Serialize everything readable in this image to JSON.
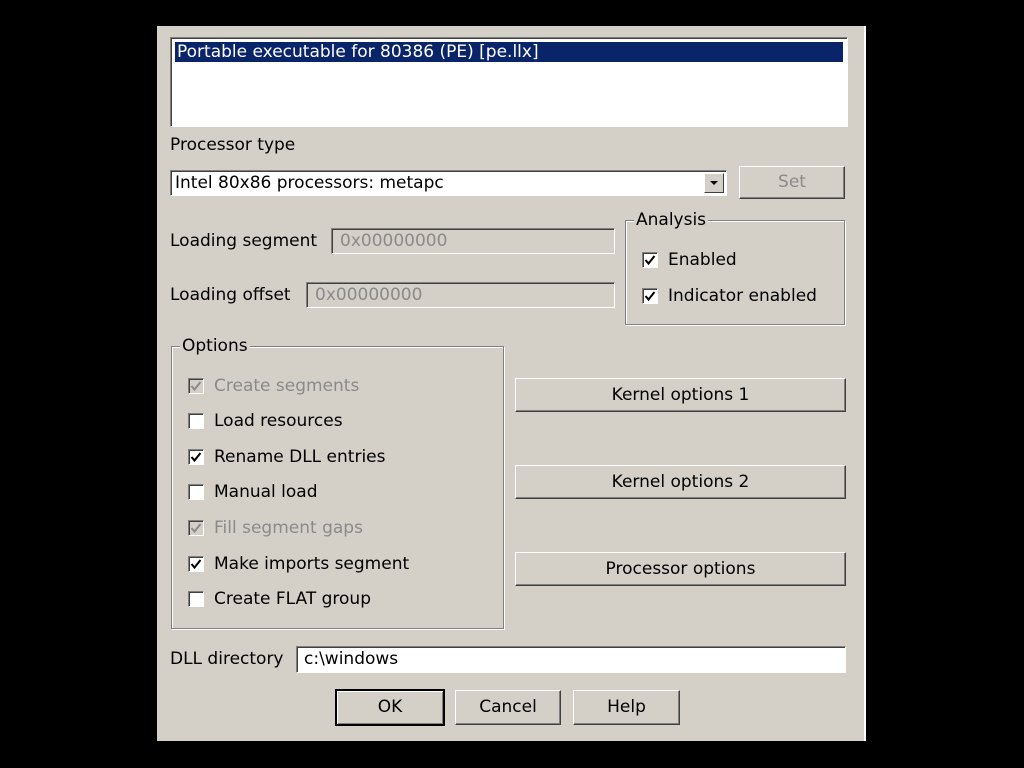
{
  "loader_list": {
    "selected": "Portable executable for 80386 (PE) [pe.llx]"
  },
  "processor": {
    "label": "Processor type",
    "value": "Intel 80x86 processors: metapc",
    "set_button": "Set"
  },
  "loading": {
    "segment_label": "Loading segment",
    "segment_value": "0x00000000",
    "offset_label": "Loading offset",
    "offset_value": "0x00000000"
  },
  "analysis": {
    "title": "Analysis",
    "items": [
      {
        "label": "Enabled",
        "checked": true,
        "disabled": false
      },
      {
        "label": "Indicator enabled",
        "checked": true,
        "disabled": false
      }
    ]
  },
  "options": {
    "title": "Options",
    "items": [
      {
        "label": "Create segments",
        "checked": true,
        "disabled": true
      },
      {
        "label": "Load resources",
        "checked": false,
        "disabled": false
      },
      {
        "label": "Rename DLL entries",
        "checked": true,
        "disabled": false
      },
      {
        "label": "Manual load",
        "checked": false,
        "disabled": false
      },
      {
        "label": "Fill segment gaps",
        "checked": true,
        "disabled": true
      },
      {
        "label": "Make imports segment",
        "checked": true,
        "disabled": false
      },
      {
        "label": "Create FLAT group",
        "checked": false,
        "disabled": false
      }
    ]
  },
  "kernel": {
    "options1": "Kernel options 1",
    "options2": "Kernel options 2",
    "processor_options": "Processor options"
  },
  "dll": {
    "label": "DLL directory",
    "value": "c:\\windows"
  },
  "buttons": {
    "ok": "OK",
    "cancel": "Cancel",
    "help": "Help"
  }
}
